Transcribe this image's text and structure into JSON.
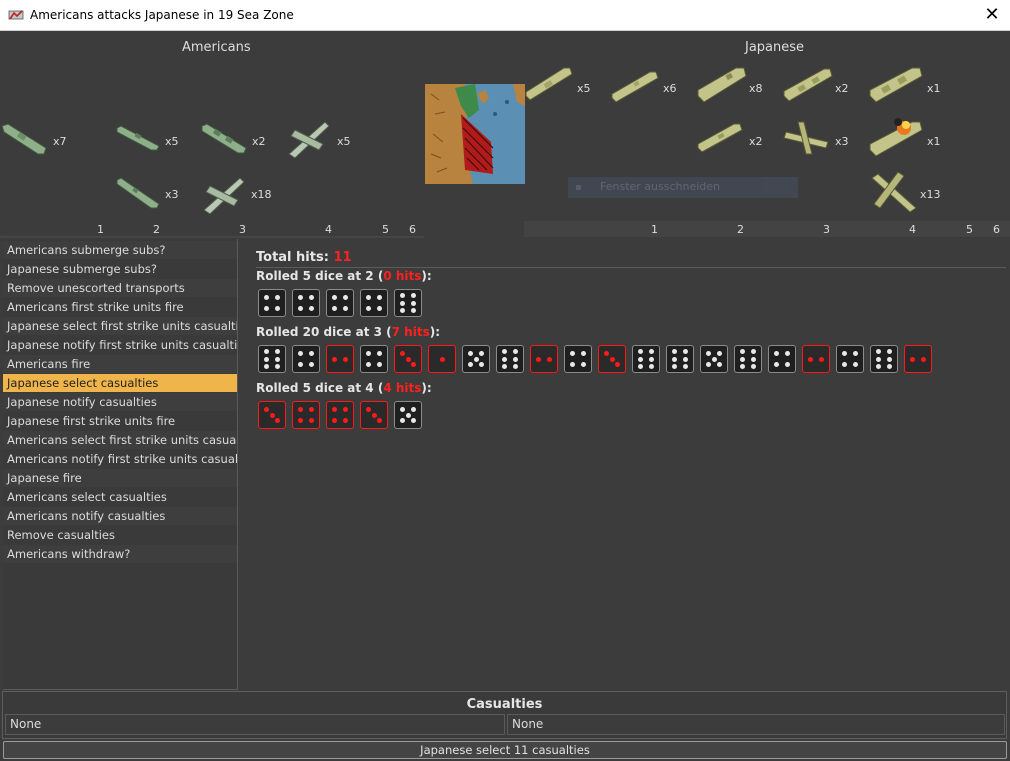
{
  "window": {
    "title": "Americans attacks Japanese in 19 Sea Zone",
    "close_label": "✕"
  },
  "americans": {
    "label": "Americans",
    "units": [
      {
        "type": "transport",
        "count": "x7"
      },
      {
        "type": "destroyer",
        "count": "x5"
      },
      {
        "type": "cruiser",
        "count": "x2"
      },
      {
        "type": "fighter",
        "count": "x5"
      },
      {
        "type": "submarine",
        "count": "x3"
      },
      {
        "type": "fighter",
        "count": "x18"
      }
    ],
    "columns": [
      "1",
      "2",
      "3",
      "4",
      "5",
      "6"
    ]
  },
  "japanese": {
    "label": "Japanese",
    "units": [
      {
        "type": "transport",
        "count": "x5"
      },
      {
        "type": "submarine",
        "count": "x6"
      },
      {
        "type": "carrier",
        "count": "x8"
      },
      {
        "type": "cruiser",
        "count": "x2"
      },
      {
        "type": "battleship",
        "count": "x1"
      },
      {
        "type": "destroyer",
        "count": "x2"
      },
      {
        "type": "fighter",
        "count": "x3"
      },
      {
        "type": "battleship-damaged",
        "count": "x1"
      },
      {
        "type": "bomber",
        "count": "x13"
      }
    ],
    "columns": [
      "1",
      "2",
      "3",
      "4",
      "5",
      "6"
    ]
  },
  "watermark": {
    "text": "Fenster ausschneiden"
  },
  "steps": [
    {
      "label": "Americans submerge subs?",
      "selected": false
    },
    {
      "label": "Japanese submerge subs?",
      "selected": false
    },
    {
      "label": "Remove unescorted transports",
      "selected": false
    },
    {
      "label": "Americans first strike units fire",
      "selected": false
    },
    {
      "label": "Japanese select first strike units casualties",
      "selected": false
    },
    {
      "label": "Japanese notify first strike units casualties",
      "selected": false
    },
    {
      "label": "Americans fire",
      "selected": false
    },
    {
      "label": "Japanese select casualties",
      "selected": true
    },
    {
      "label": "Japanese notify casualties",
      "selected": false
    },
    {
      "label": "Japanese first strike units fire",
      "selected": false
    },
    {
      "label": "Americans select first strike units casualties",
      "selected": false
    },
    {
      "label": "Americans notify first strike units casualties",
      "selected": false
    },
    {
      "label": "Japanese fire",
      "selected": false
    },
    {
      "label": "Americans select casualties",
      "selected": false
    },
    {
      "label": "Americans notify casualties",
      "selected": false
    },
    {
      "label": "Remove casualties",
      "selected": false
    },
    {
      "label": "Americans withdraw?",
      "selected": false
    }
  ],
  "dice": {
    "total_label": "Total hits:",
    "total_value": "11",
    "rolls": [
      {
        "prefix": "Rolled 5 dice at 2 (",
        "hits": "0 hits",
        "suffix": "):",
        "dice": [
          {
            "v": 4,
            "hit": false
          },
          {
            "v": 4,
            "hit": false
          },
          {
            "v": 4,
            "hit": false
          },
          {
            "v": 4,
            "hit": false
          },
          {
            "v": 6,
            "hit": false
          }
        ]
      },
      {
        "prefix": "Rolled 20 dice at 3 (",
        "hits": "7 hits",
        "suffix": "):",
        "dice": [
          {
            "v": 6,
            "hit": false
          },
          {
            "v": 4,
            "hit": false
          },
          {
            "v": 2,
            "hit": true
          },
          {
            "v": 4,
            "hit": false
          },
          {
            "v": 3,
            "hit": true
          },
          {
            "v": 1,
            "hit": true
          },
          {
            "v": 5,
            "hit": false
          },
          {
            "v": 6,
            "hit": false
          },
          {
            "v": 2,
            "hit": true
          },
          {
            "v": 4,
            "hit": false
          },
          {
            "v": 3,
            "hit": true
          },
          {
            "v": 6,
            "hit": false
          },
          {
            "v": 6,
            "hit": false
          },
          {
            "v": 5,
            "hit": false
          },
          {
            "v": 6,
            "hit": false
          },
          {
            "v": 4,
            "hit": false
          },
          {
            "v": 2,
            "hit": true
          },
          {
            "v": 4,
            "hit": false
          },
          {
            "v": 6,
            "hit": false
          },
          {
            "v": 2,
            "hit": true
          }
        ]
      },
      {
        "prefix": "Rolled 5 dice at 4 (",
        "hits": "4 hits",
        "suffix": "):",
        "dice": [
          {
            "v": 3,
            "hit": true
          },
          {
            "v": 4,
            "hit": true
          },
          {
            "v": 4,
            "hit": true
          },
          {
            "v": 3,
            "hit": true
          },
          {
            "v": 5,
            "hit": false
          }
        ]
      }
    ]
  },
  "casualties": {
    "title": "Casualties",
    "left": "None",
    "right": "None"
  },
  "status_button": "Japanese select 11 casualties",
  "colors": {
    "selected": "#f0b54a",
    "hit": "#ff1a1a",
    "us_unit": "#8fae8a",
    "jp_unit": "#c2c489"
  }
}
